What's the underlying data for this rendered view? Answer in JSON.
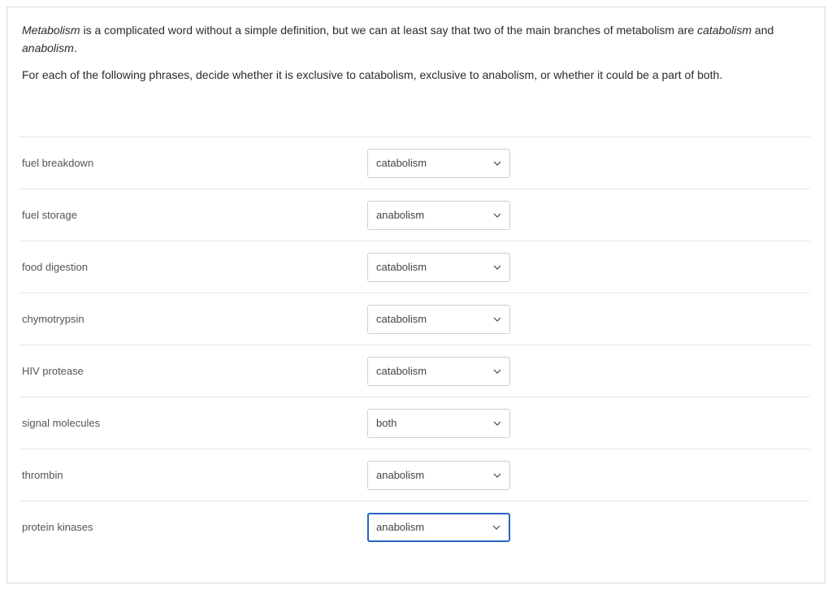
{
  "intro": {
    "parts": [
      {
        "italic": true,
        "text": "Metabolism"
      },
      {
        "italic": false,
        "text": " is a complicated word without a simple definition, but we can at least say that two of the main branches of metabolism are "
      },
      {
        "italic": true,
        "text": "catabolism"
      },
      {
        "italic": false,
        "text": " and "
      },
      {
        "italic": true,
        "text": "anabolism"
      },
      {
        "italic": false,
        "text": "."
      }
    ]
  },
  "instruction": "For each of the following phrases, decide whether it is exclusive to catabolism, exclusive to anabolism, or whether it could be a part of both.",
  "options": [
    "catabolism",
    "anabolism",
    "both"
  ],
  "rows": [
    {
      "label": "fuel breakdown",
      "selected": "catabolism",
      "focused": false
    },
    {
      "label": "fuel storage",
      "selected": "anabolism",
      "focused": false
    },
    {
      "label": "food digestion",
      "selected": "catabolism",
      "focused": false
    },
    {
      "label": "chymotrypsin",
      "selected": "catabolism",
      "focused": false
    },
    {
      "label": "HIV protease",
      "selected": "catabolism",
      "focused": false
    },
    {
      "label": "signal molecules",
      "selected": "both",
      "focused": false
    },
    {
      "label": "thrombin",
      "selected": "anabolism",
      "focused": false
    },
    {
      "label": "protein kinases",
      "selected": "anabolism",
      "focused": true
    }
  ]
}
